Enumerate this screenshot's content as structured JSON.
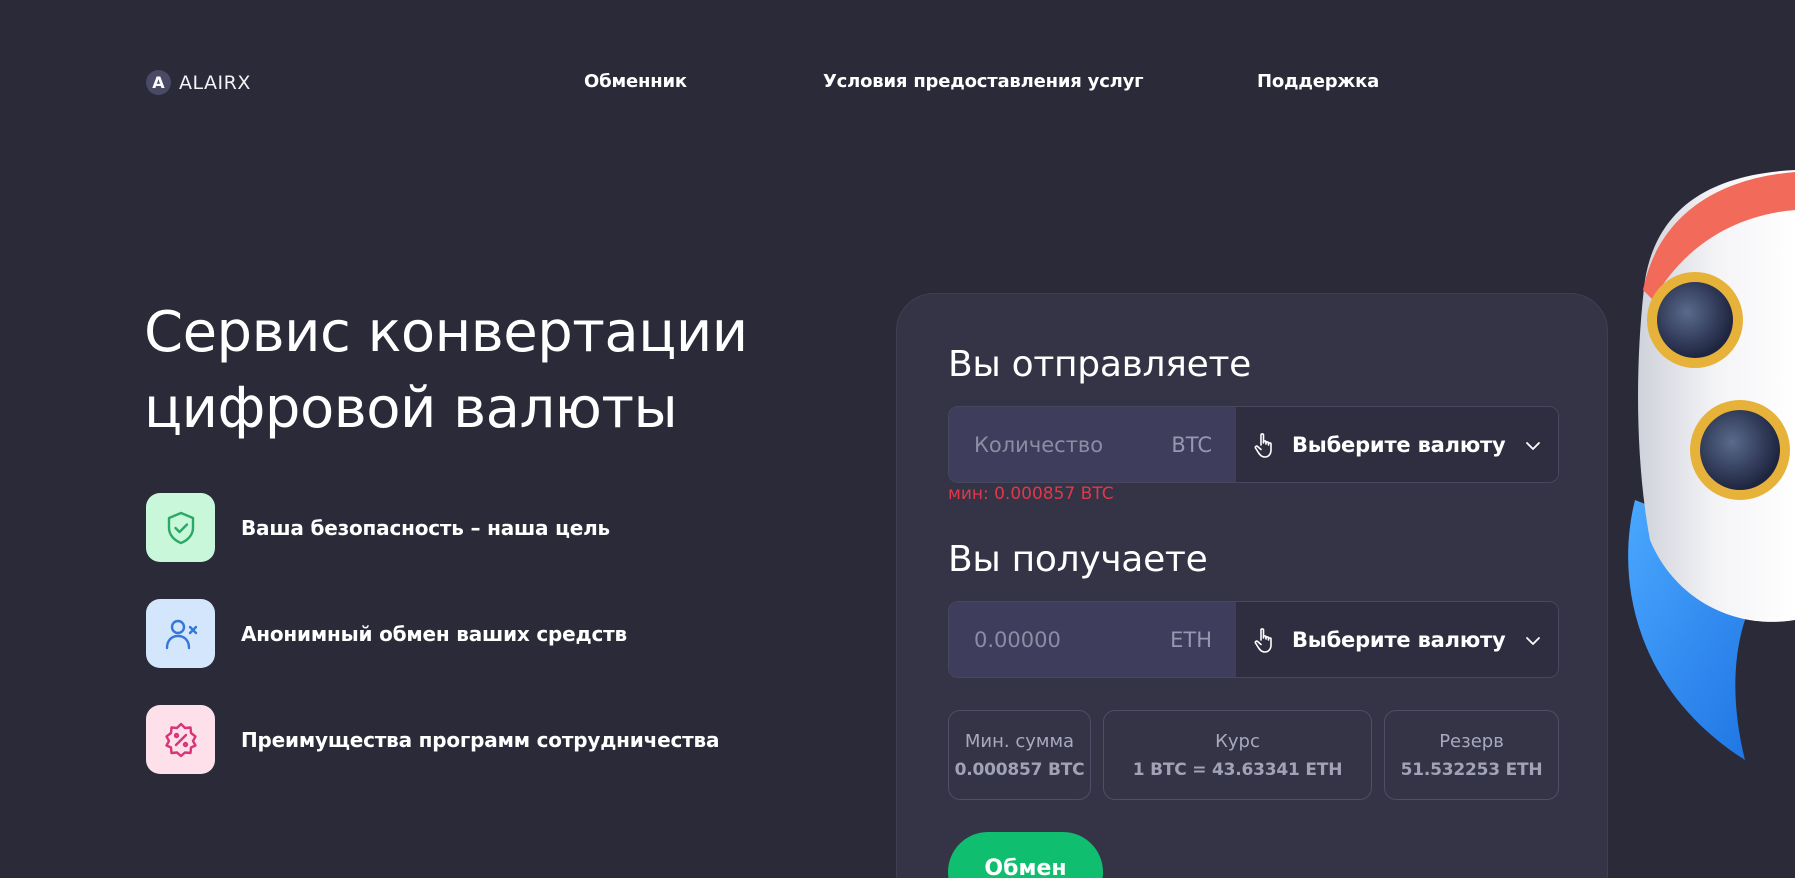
{
  "header": {
    "logo_mark": "A",
    "logo_text": "ALAIRX",
    "nav": [
      {
        "label": "Обменник"
      },
      {
        "label": "Условия предоставления услуг"
      },
      {
        "label": "Поддержка"
      }
    ]
  },
  "hero": {
    "title_line1": "Сервис конвертации",
    "title_line2": "цифровой валюты",
    "features": [
      {
        "label": "Ваша безопасность – наша цель",
        "icon": "shield-check-icon",
        "bg": "#c9f7d9",
        "color": "#2aa866"
      },
      {
        "label": "Анонимный обмен ваших средств",
        "icon": "user-x-icon",
        "bg": "#d4e6fc",
        "color": "#3577d6"
      },
      {
        "label": "Преимущества программ сотрудничества",
        "icon": "discount-badge-icon",
        "bg": "#fde0ea",
        "color": "#d63577"
      }
    ]
  },
  "exchange": {
    "send": {
      "title": "Вы отправляете",
      "placeholder": "Количество",
      "unit": "BTC",
      "select_label": "Выберите валюту",
      "min_note": "мин: 0.000857 BTC"
    },
    "receive": {
      "title": "Вы получаете",
      "placeholder": "0.00000",
      "unit": "ETH",
      "select_label": "Выберите валюту"
    },
    "info": {
      "min_sum_label": "Мин. сумма",
      "min_sum_value": "0.000857 BTC",
      "rate_label": "Курс",
      "rate_value": "1 BTC = 43.63341 ETH",
      "reserve_label": "Резерв",
      "reserve_value": "51.532253 ETH"
    },
    "button_label": "Обмен"
  },
  "colors": {
    "background": "#2a2a38",
    "card": "#343446",
    "accent_green": "#0fbf6f",
    "error_red": "#e0384b"
  }
}
